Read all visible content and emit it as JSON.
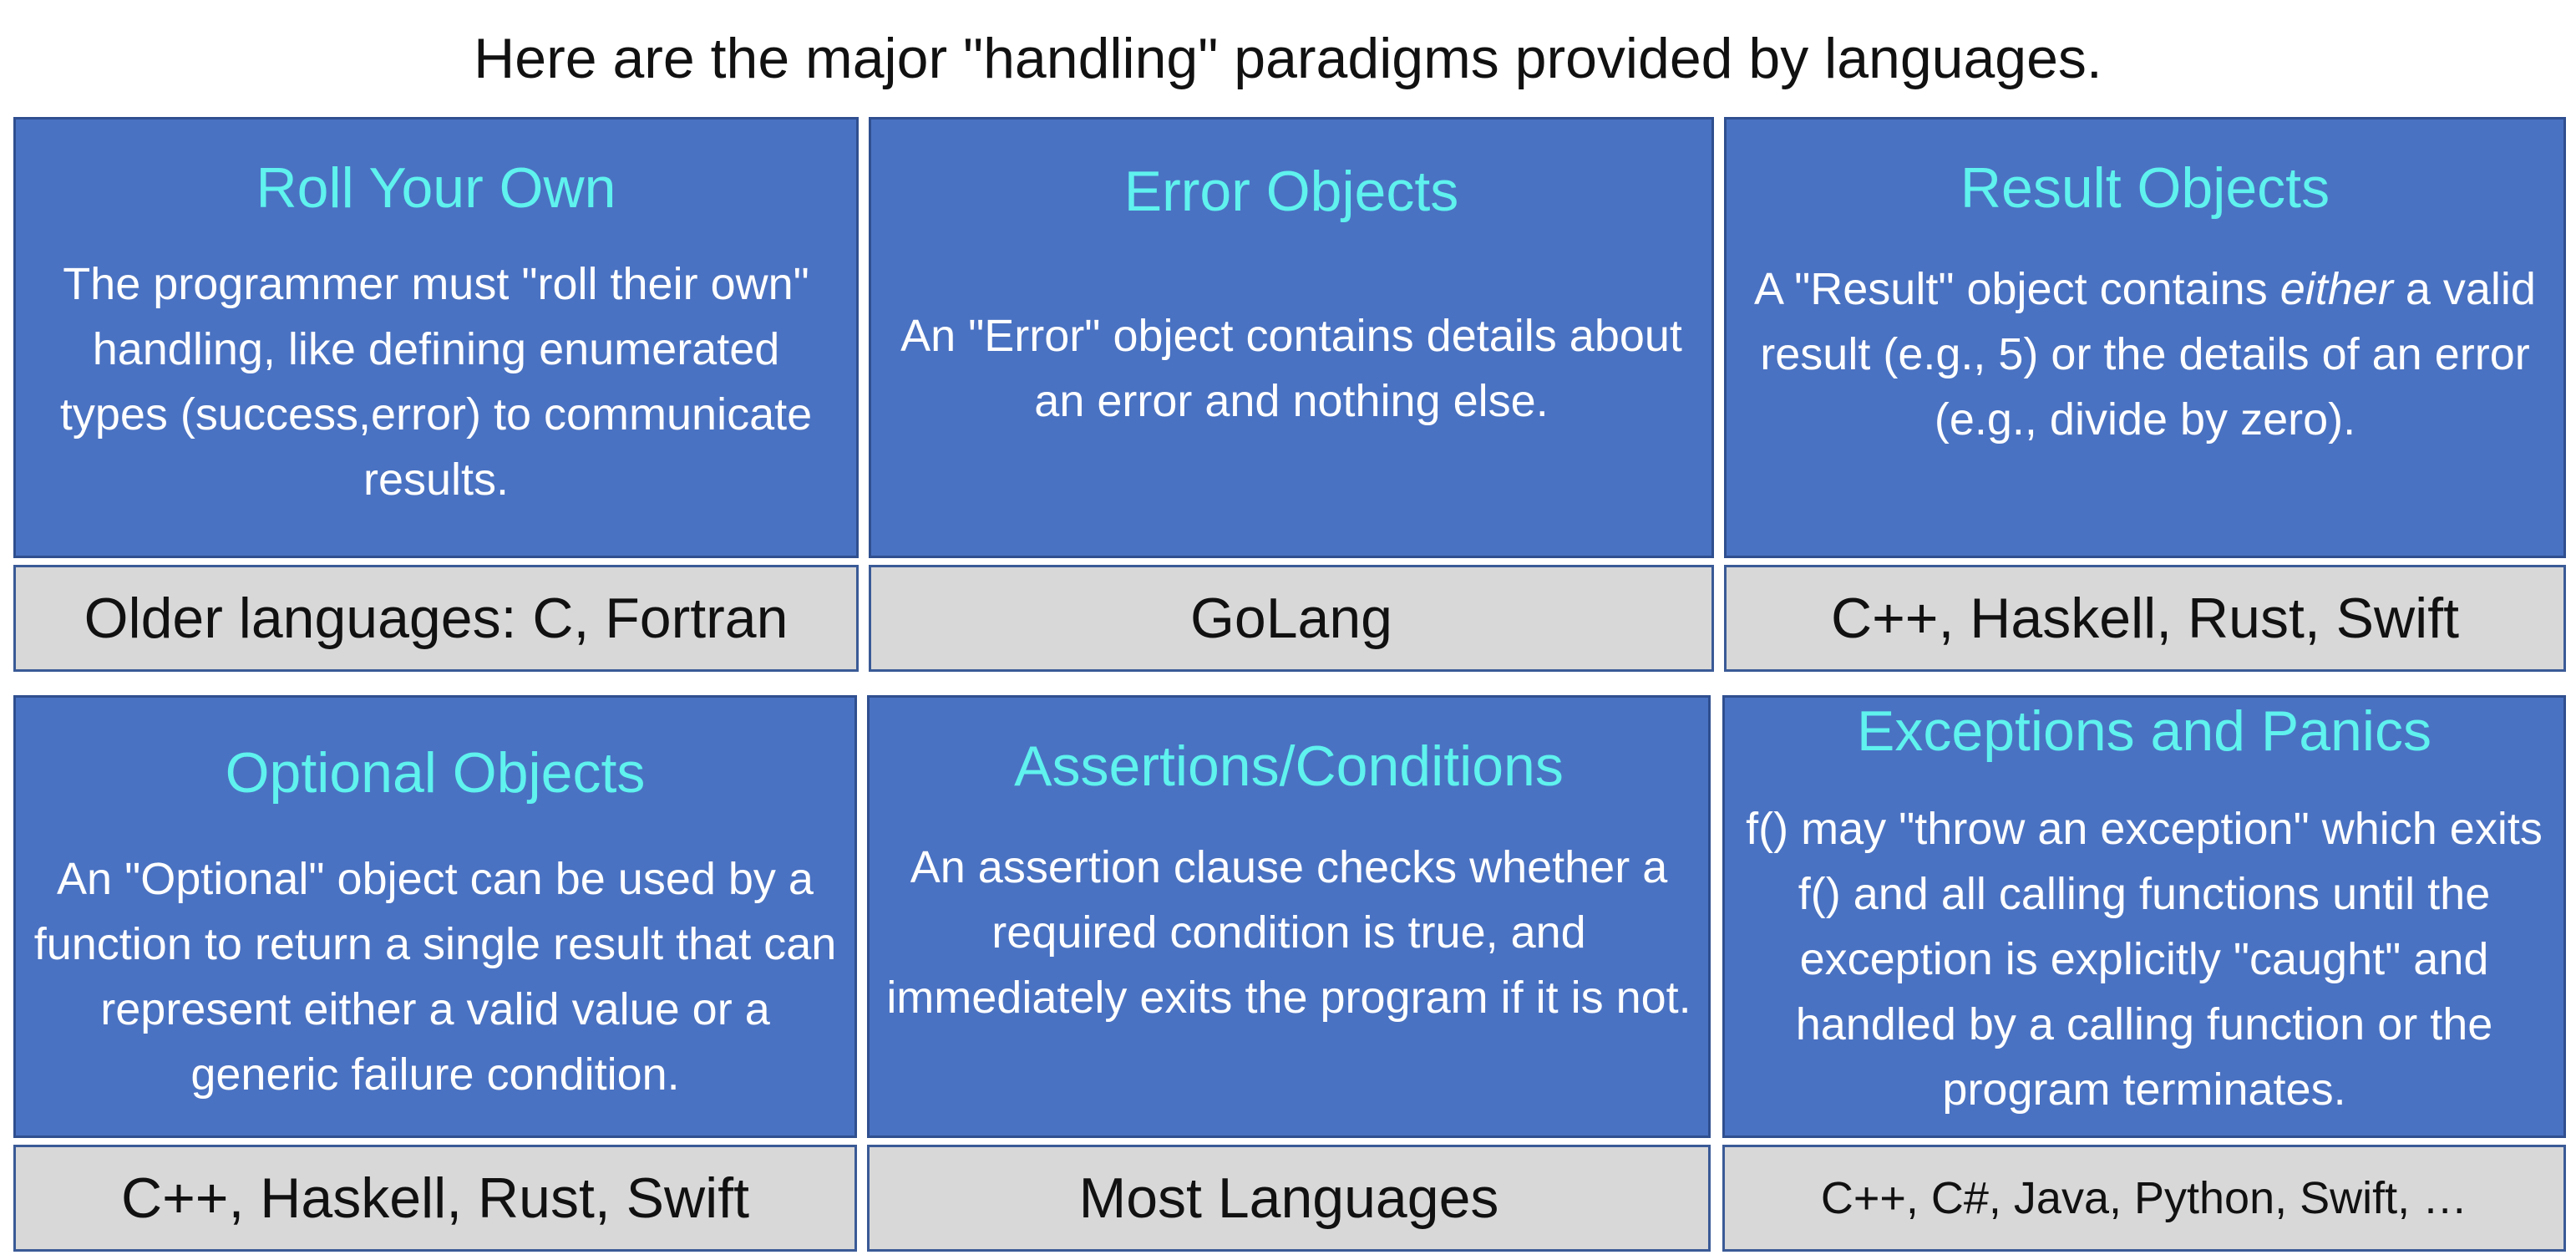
{
  "title": "Here are the major \"handling\" paradigms provided by languages.",
  "cards": [
    {
      "title": "Roll Your Own",
      "description": "The programmer must \"roll their own\" handling, like defining enumerated types (success,error) to communicate results.",
      "languages": "Older languages: C, Fortran"
    },
    {
      "title": "Error Objects",
      "description": "An \"Error\" object contains details about an error and nothing else.",
      "languages": "GoLang"
    },
    {
      "title": "Result Objects",
      "description_before": "A \"Result\" object contains ",
      "description_emphasis": "either",
      "description_after": " a valid result (e.g., 5) or the details of an error (e.g., divide by zero).",
      "languages": "C++, Haskell, Rust, Swift"
    },
    {
      "title": "Optional Objects",
      "description": "An \"Optional\" object can be used by a function to return a single result that can represent either a valid value or a generic failure condition.",
      "languages": "C++, Haskell, Rust, Swift"
    },
    {
      "title": "Assertions/Conditions",
      "description": "An assertion clause checks whether a required condition is true, and immediately exits the program if it is not.",
      "languages": "Most Languages"
    },
    {
      "title": "Exceptions and Panics",
      "description": "f() may \"throw an exception\" which exits f() and all calling functions until the exception is explicitly \"caught\" and handled by a calling function or the program terminates.",
      "languages": "C++, C#, Java, Python, Swift, …"
    }
  ],
  "colors": {
    "card_background": "#4a72c2",
    "card_title": "#5ff2ee",
    "language_background": "#d8d8d8"
  }
}
